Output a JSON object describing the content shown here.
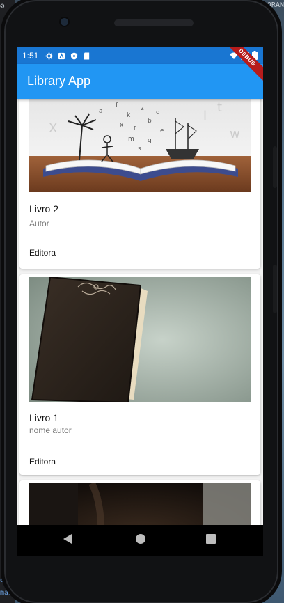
{
  "desktop": {
    "corner_text": "ORAN",
    "corner_left_glyph": "⊘",
    "ide_lines": [
      "e",
      "mais"
    ]
  },
  "status_bar": {
    "time": "1:51"
  },
  "app_bar": {
    "title": "Library App",
    "debug_banner": "DEBUG"
  },
  "books": [
    {
      "title": "Livro 2",
      "author": "Autor",
      "publisher": "Editora",
      "image": "open-book-illustration"
    },
    {
      "title": "Livro 1",
      "author": "nome autor",
      "publisher": "Editora",
      "image": "old-leather-book"
    },
    {
      "title": "",
      "author": "",
      "publisher": "",
      "image": "dark-photo"
    }
  ],
  "nav": {
    "back": "back-icon",
    "home": "home-icon",
    "recents": "recents-icon"
  },
  "colors": {
    "status_bar": "#1976d2",
    "app_bar": "#2196f3",
    "debug": "#b71c1c"
  }
}
